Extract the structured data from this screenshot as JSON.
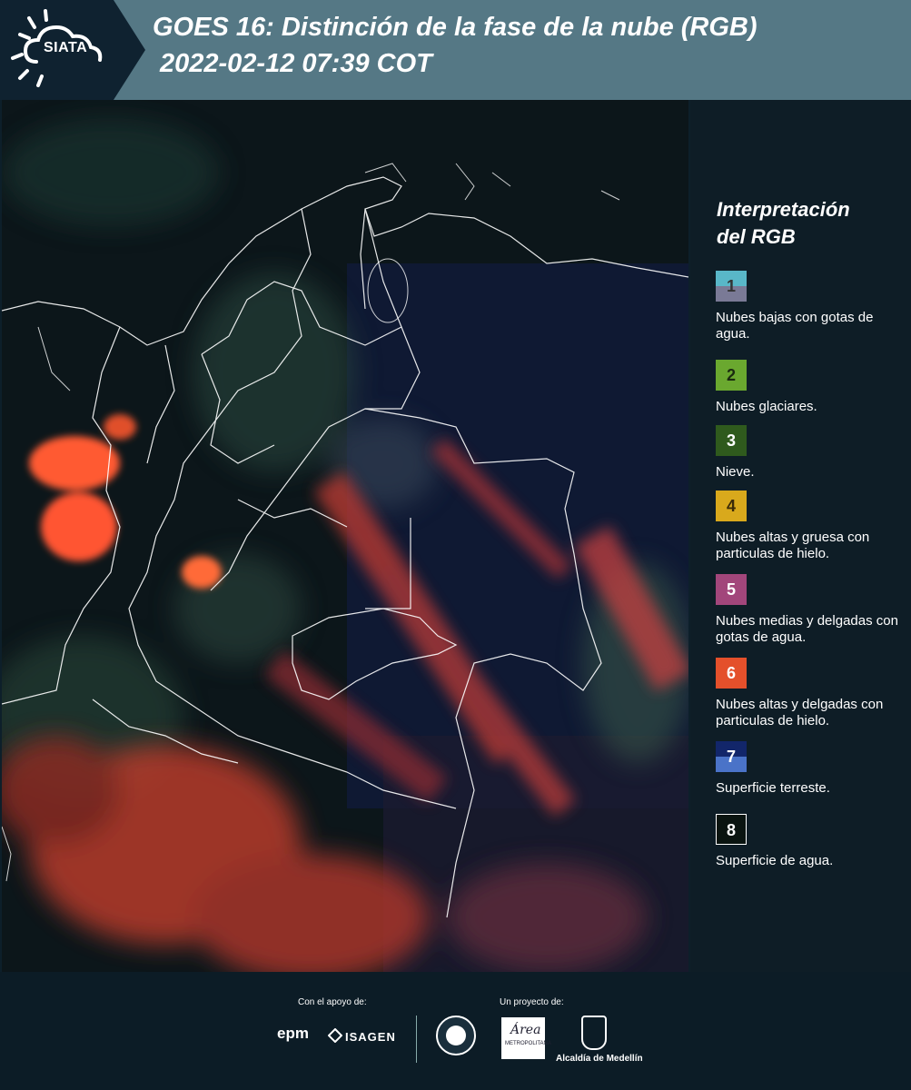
{
  "header": {
    "logo_text": "SIATA",
    "title_line1": "GOES 16: Distinción de la fase de la nube (RGB)",
    "title_line2": "2022-02-12 07:39 COT"
  },
  "legend": {
    "title_line1": "Interpretación",
    "title_line2": "del RGB",
    "items": [
      {
        "number": "1",
        "label": "Nubes bajas con gotas de agua.",
        "color_top": "#59b7c8",
        "color_bottom": "#7a7a96"
      },
      {
        "number": "2",
        "label": "Nubes glaciares.",
        "color_top": "#6aa82f",
        "color_bottom": "#6aa82f"
      },
      {
        "number": "3",
        "label": "Nieve.",
        "color_top": "#2f5a1d",
        "color_bottom": "#2f5a1d"
      },
      {
        "number": "4",
        "label": "Nubes altas y gruesa con particulas de hielo.",
        "color_top": "#d9a91c",
        "color_bottom": "#d9a91c"
      },
      {
        "number": "5",
        "label": "Nubes medias y delgadas con gotas de agua.",
        "color_top": "#a2467b",
        "color_bottom": "#a2467b"
      },
      {
        "number": "6",
        "label": "Nubes altas y delgadas con particulas de hielo.",
        "color_top": "#e4502b",
        "color_bottom": "#e4502b"
      },
      {
        "number": "7",
        "label": "Superficie terreste.",
        "color_top": "#12266a",
        "color_bottom": "#4a73c8"
      },
      {
        "number": "8",
        "label": "Superficie de agua.",
        "color_top": "#0a1410",
        "color_bottom": "#0a1410"
      }
    ]
  },
  "footer": {
    "support_label": "Con el apoyo de:",
    "project_label": "Un proyecto de:",
    "sponsor1": "epm",
    "sponsor2": "ISAGEN",
    "partner_area": "METROPOLITANA",
    "partner_alcaldia": "Alcaldía de Medellín"
  }
}
